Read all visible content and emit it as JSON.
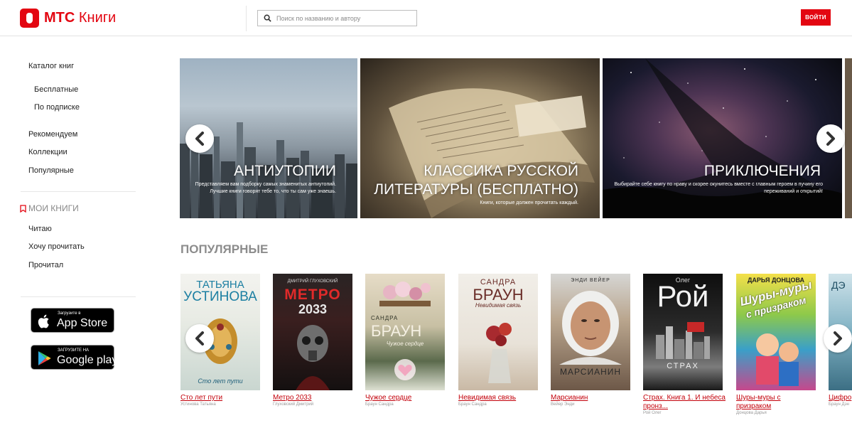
{
  "header": {
    "logo_brand": "МТС",
    "logo_product": "Книги",
    "search_placeholder": "Поиск по названию и автору",
    "login_label": "ВОЙТИ"
  },
  "sidebar": {
    "catalog": "Каталог книг",
    "free": "Бесплатные",
    "subscription": "По подписке",
    "recommend": "Рекомендуем",
    "collections": "Коллекции",
    "popular": "Популярные",
    "my_books": "МОИ КНИГИ",
    "reading": "Читаю",
    "want_read": "Хочу прочитать",
    "read": "Прочитал",
    "app_store_small": "Загрузите в",
    "app_store_big": "App Store",
    "google_play_small": "ЗАГРУЗИТЕ НА",
    "google_play_big": "Google play"
  },
  "banners": [
    {
      "title": "АНТИУТОПИИ",
      "desc": "Представляем вам подборку самых знаменитых антиутопий. Лучшие книги говорят тебе то, что ты сам уже знаешь."
    },
    {
      "title_line1": "КЛАССИКА РУССКОЙ",
      "title_line2": "ЛИТЕРАТУРЫ (БЕСПЛАТНО)",
      "desc": "Книги, которые должен прочитать каждый."
    },
    {
      "title": "ПРИКЛЮЧЕНИЯ",
      "desc": "Выбирайте себе книгу по нраву и скорее окунитесь вместе с главным героем в пучину его переживаний и открытий!"
    }
  ],
  "popular": {
    "title": "ПОПУЛЯРНЫЕ",
    "books": [
      {
        "title": "Сто лет пути",
        "author": "Устинова Татьяна",
        "cover_top": "ТАТЬЯНА",
        "cover_main": "УСТИНОВА",
        "cover_bottom": "Сто лет пути"
      },
      {
        "title": "Метро 2033",
        "author": "Глуховский Дмитрий",
        "cover_top": "ДМИТРИЙ ГЛУХОВСКИЙ",
        "cover_main": "МЕТРО",
        "cover_bottom": "2033"
      },
      {
        "title": "Чужое сердце",
        "author": "Браун Сандра",
        "cover_top": "САНДРА",
        "cover_main": "БРАУН",
        "cover_bottom": "Чужое сердце"
      },
      {
        "title": "Невидимая связь",
        "author": "Браун Сандра",
        "cover_top": "САНДРА",
        "cover_main": "БРАУН",
        "cover_bottom": "Невидимая связь"
      },
      {
        "title": "Марсианин",
        "author": "Вейер Энди",
        "cover_top": "ЭНДИ ВЕЙЕР",
        "cover_main": "",
        "cover_bottom": "МАРСИАНИН"
      },
      {
        "title_line1": "Страх. Книга 1. И небеса",
        "title_line2": "пронз...",
        "author": "Рой Олег",
        "cover_top": "Олег",
        "cover_main": "Рой",
        "cover_bottom": "СТРАХ"
      },
      {
        "title_line1": "Шуры-муры с",
        "title_line2": "призраком",
        "author": "Донцова Дарья",
        "cover_top": "ДАРЬЯ ДОНЦОВА",
        "cover_main": "Шуры-муры",
        "cover_bottom": "с призраком"
      },
      {
        "title": "Цифро",
        "author": "Браун Дэн",
        "cover_top": "ДЭ",
        "cover_main": "",
        "cover_bottom": ""
      }
    ]
  },
  "colors": {
    "accent": "#e30611",
    "link": "#c3000a",
    "muted": "#8c8c8c"
  },
  "icons": [
    "search-icon",
    "bookmark-icon",
    "apple-icon",
    "google-play-icon",
    "chevron-left-icon",
    "chevron-right-icon"
  ]
}
